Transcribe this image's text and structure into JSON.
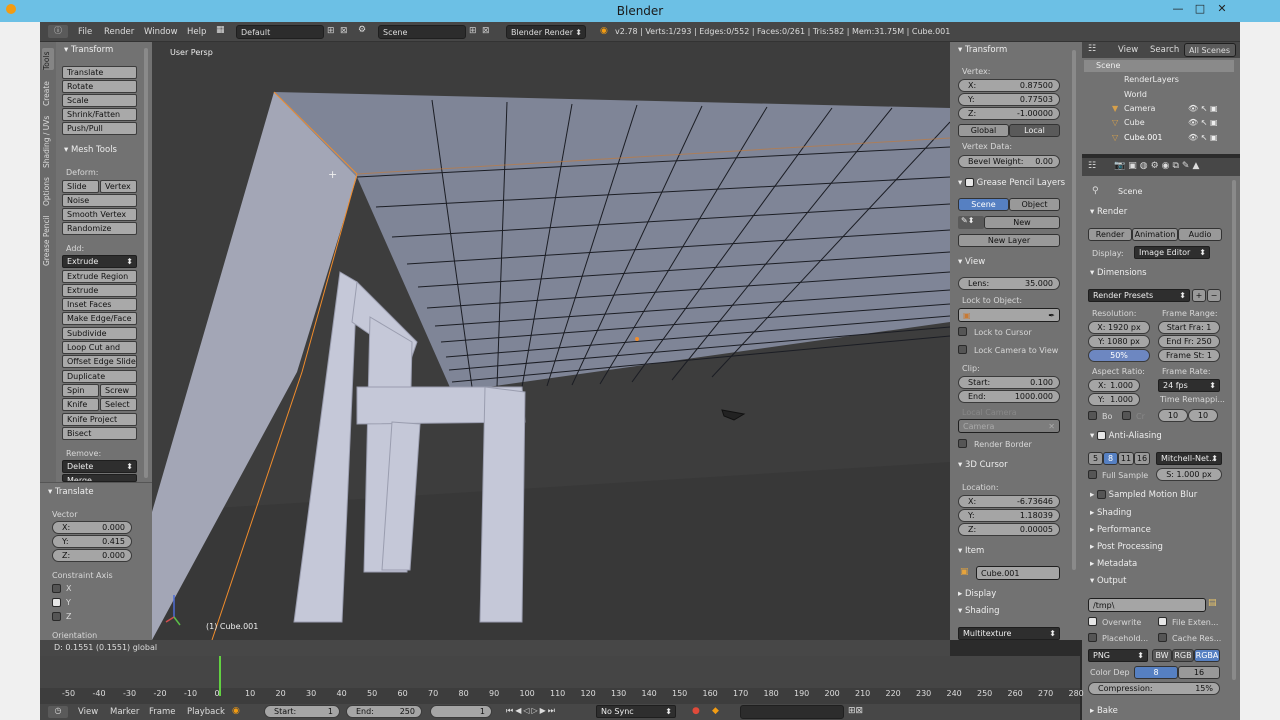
{
  "window": {
    "title": "Blender"
  },
  "topbar": {
    "menus": [
      "File",
      "Render",
      "Window",
      "Help"
    ],
    "layout": "Default",
    "scene": "Scene",
    "engine": "Blender Render",
    "stats": "v2.78 | Verts:1/293 | Edges:0/552 | Faces:0/261 | Tris:582 | Mem:31.75M | Cube.001"
  },
  "left_tabs": [
    "Tools",
    "Create",
    "Shading / UVs",
    "Options",
    "Grease Pencil"
  ],
  "toolshelf": {
    "transform_header": "Transform",
    "transform": [
      "Translate",
      "Rotate",
      "Scale",
      "Shrink/Fatten",
      "Push/Pull"
    ],
    "mesh_header": "Mesh Tools",
    "deform_label": "Deform:",
    "slide_edge": "Slide Ed",
    "vertex": "Vertex",
    "noise": "Noise",
    "smooth": "Smooth Vertex",
    "randomize": "Randomize",
    "add_label": "Add:",
    "extrude": "Extrude",
    "add_tools": [
      "Extrude Region",
      "Extrude Individual",
      "Inset Faces",
      "Make Edge/Face",
      "Subdivide",
      "Loop Cut and Slide",
      "Offset Edge Slide",
      "Duplicate"
    ],
    "spin": "Spin",
    "screw": "Screw",
    "knife": "Knife",
    "select": "Select",
    "knife_project": "Knife Project",
    "bisect": "Bisect",
    "remove_label": "Remove:",
    "delete": "Delete",
    "merge": "Merge"
  },
  "operator": {
    "header": "Translate",
    "vector_label": "Vector",
    "x_label": "X:",
    "x": "0.000",
    "y_label": "Y:",
    "y": "0.415",
    "z_label": "Z:",
    "z": "0.000",
    "constraint_label": "Constraint Axis",
    "axes": [
      "X",
      "Y",
      "Z"
    ],
    "orientation_label": "Orientation"
  },
  "viewport": {
    "label": "User Persp",
    "object_label": "(1) Cube.001"
  },
  "npanel": {
    "transform_header": "Transform",
    "vertex_label": "Vertex:",
    "vx_label": "X:",
    "vx": "0.87500",
    "vy_label": "Y:",
    "vy": "0.77503",
    "vz_label": "Z:",
    "vz": "-1.00000",
    "global": "Global",
    "local": "Local",
    "vertex_data": "Vertex Data:",
    "bevel_label": "Bevel Weight:",
    "bevel": "0.00",
    "gp_header": "Grease Pencil Layers",
    "gp_scene": "Scene",
    "gp_object": "Object",
    "gp_new": "New",
    "gp_new_layer": "New Layer",
    "view_header": "View",
    "lens_label": "Lens:",
    "lens": "35.000",
    "lock_obj": "Lock to Object:",
    "lock_cursor": "Lock to Cursor",
    "lock_camera": "Lock Camera to View",
    "clip_label": "Clip:",
    "start_label": "Start:",
    "start": "0.100",
    "end_label": "End:",
    "end": "1000.000",
    "local_camera": "Local Camera",
    "camera": "Camera",
    "render_border": "Render Border",
    "cursor_header": "3D Cursor",
    "location_label": "Location:",
    "cx_label": "X:",
    "cx": "-6.73646",
    "cy_label": "Y:",
    "cy": "1.18039",
    "cz_label": "Z:",
    "cz": "0.00005",
    "item_header": "Item",
    "item_name": "Cube.001",
    "display_header": "Display",
    "shading_header": "Shading",
    "shading_mode": "Multitexture"
  },
  "outliner": {
    "view": "View",
    "search": "Search",
    "filter": "All Scenes",
    "items": [
      "Scene",
      "RenderLayers",
      "World",
      "Camera",
      "Cube",
      "Cube.001"
    ]
  },
  "props": {
    "scene": "Scene",
    "render_header": "Render",
    "render_btn": "Render",
    "anim_btn": "Animation",
    "audio_btn": "Audio",
    "display_label": "Display:",
    "display_val": "Image Editor",
    "dimensions_header": "Dimensions",
    "presets": "Render Presets",
    "resolution_label": "Resolution:",
    "frame_range_label": "Frame Range:",
    "res_x": "X: 1920 px",
    "res_y": "Y: 1080 px",
    "res_pct": "50%",
    "start_fra": "Start Fra: 1",
    "end_fr": "End Fr: 250",
    "frame_st": "Frame St: 1",
    "aspect_label": "Aspect Ratio:",
    "frame_rate_label": "Frame Rate:",
    "asp_x": "X:",
    "asp_x_v": "1.000",
    "asp_y": "Y:",
    "asp_y_v": "1.000",
    "fps": "24 fps",
    "time_remap": "Time Remappi...",
    "bo": "Bo",
    "cr": "Cr",
    "remap_a": "10",
    "remap_b": "10",
    "aa_header": "Anti-Aliasing",
    "aa_samples": [
      "5",
      "8",
      "11",
      "16"
    ],
    "aa_filter": "Mitchell-Net...",
    "full_sample": "Full Sample",
    "filter_size": "S: 1.000 px",
    "smb": "Sampled Motion Blur",
    "shading": "Shading",
    "performance": "Performance",
    "post": "Post Processing",
    "metadata": "Metadata",
    "output_header": "Output",
    "output_path": "/tmp\\",
    "overwrite": "Overwrite",
    "file_ext": "File Exten...",
    "placeholders": "Placehold...",
    "cache": "Cache Res...",
    "format": "PNG",
    "bw": "BW",
    "rgb": "RGB",
    "rgba": "RGBA",
    "color_depth": "Color Dep",
    "depth8": "8",
    "depth16": "16",
    "compression": "Compression:",
    "compression_val": "15%",
    "bake": "Bake"
  },
  "status": {
    "text": "D: 0.1551 (0.1551) global"
  },
  "timeline": {
    "ticks": [
      "-50",
      "-40",
      "-30",
      "-20",
      "-10",
      "0",
      "10",
      "20",
      "30",
      "40",
      "50",
      "60",
      "70",
      "80",
      "90",
      "100",
      "110",
      "120",
      "130",
      "140",
      "150",
      "160",
      "170",
      "180",
      "190",
      "200",
      "210",
      "220",
      "230",
      "240",
      "250",
      "260",
      "270",
      "280"
    ],
    "current": 1
  },
  "footer": {
    "view": "View",
    "marker": "Marker",
    "frame": "Frame",
    "playback": "Playback",
    "start_label": "Start:",
    "start": "1",
    "end_label": "End:",
    "end": "250",
    "current": "1",
    "sync": "No Sync"
  },
  "colors": {
    "accent": "#5680c2",
    "selection": "#f08c2c",
    "titlebar": "#6cc0e5"
  }
}
